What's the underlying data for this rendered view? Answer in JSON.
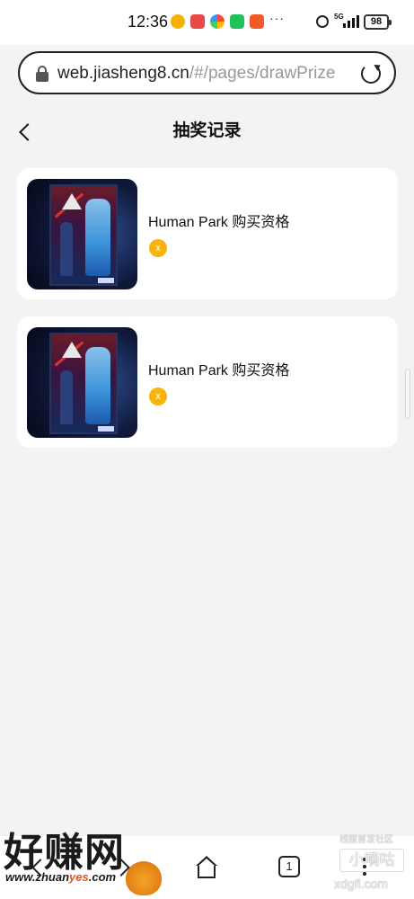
{
  "status_bar": {
    "time": "12:36",
    "network": "5G",
    "battery": "98",
    "more": "···"
  },
  "browser": {
    "url_host": "web.jiasheng8.cn",
    "url_path": "/#/pages/drawPrize"
  },
  "header": {
    "title": "抽奖记录"
  },
  "records": [
    {
      "title": "Human Park 购买资格",
      "badge": "x"
    },
    {
      "title": "Human Park 购买资格",
      "badge": "x"
    }
  ],
  "bottom_nav": {
    "tab_count": "1"
  },
  "watermarks": {
    "left_big": "好赚网",
    "left_small_a": "www.zhuan",
    "left_small_b": "yes",
    "left_small_c": ".com",
    "right_small": "线报首发社区",
    "right_big": "小嘀咕",
    "right_domain": "xdgfl.com"
  },
  "colors": {
    "page_bg": "#f2f3f5",
    "card_bg": "#ffffff",
    "badge": "#f5b50a"
  },
  "icons": [
    "lock-icon",
    "reload-icon",
    "back-icon",
    "home-icon",
    "tabs-icon",
    "menu-icon"
  ]
}
